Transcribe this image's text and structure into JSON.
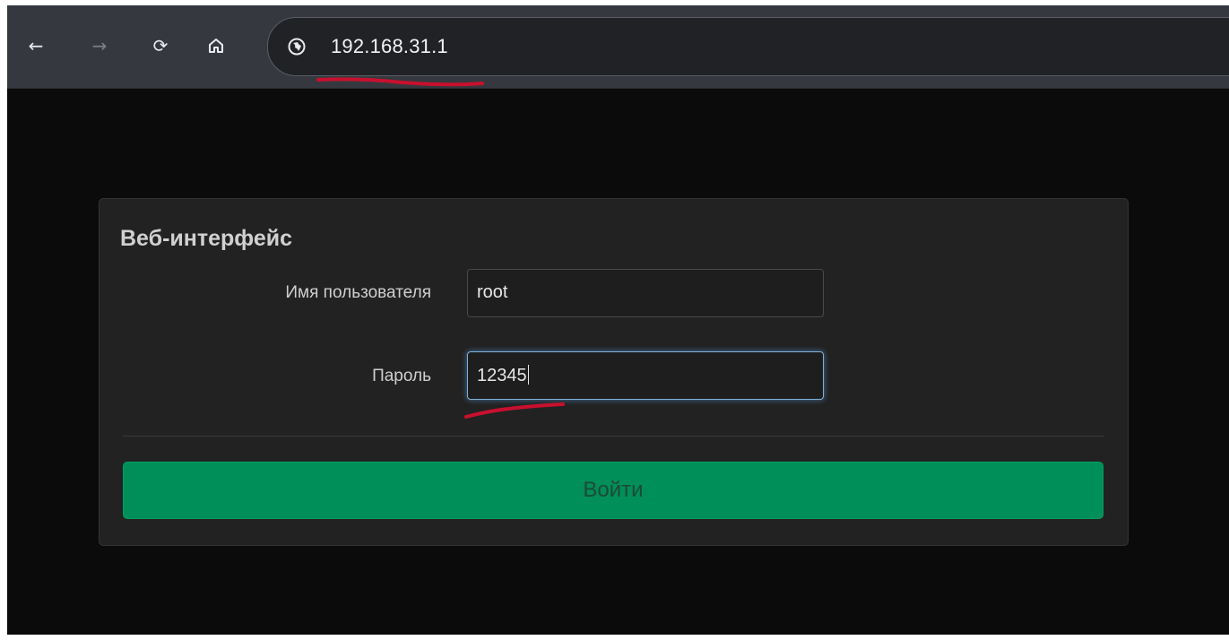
{
  "browser": {
    "url": "192.168.31.1",
    "icons": {
      "back": "arrow-left-icon",
      "forward": "arrow-right-icon",
      "reload": "reload-icon",
      "home": "home-icon",
      "site": "globe-icon"
    }
  },
  "login": {
    "title": "Веб-интерфейс",
    "username_label": "Имя пользователя",
    "username_value": "root",
    "password_label": "Пароль",
    "password_value": "12345",
    "submit_label": "Войти"
  },
  "colors": {
    "accent": "#008f58",
    "annotation": "#c8102e"
  }
}
